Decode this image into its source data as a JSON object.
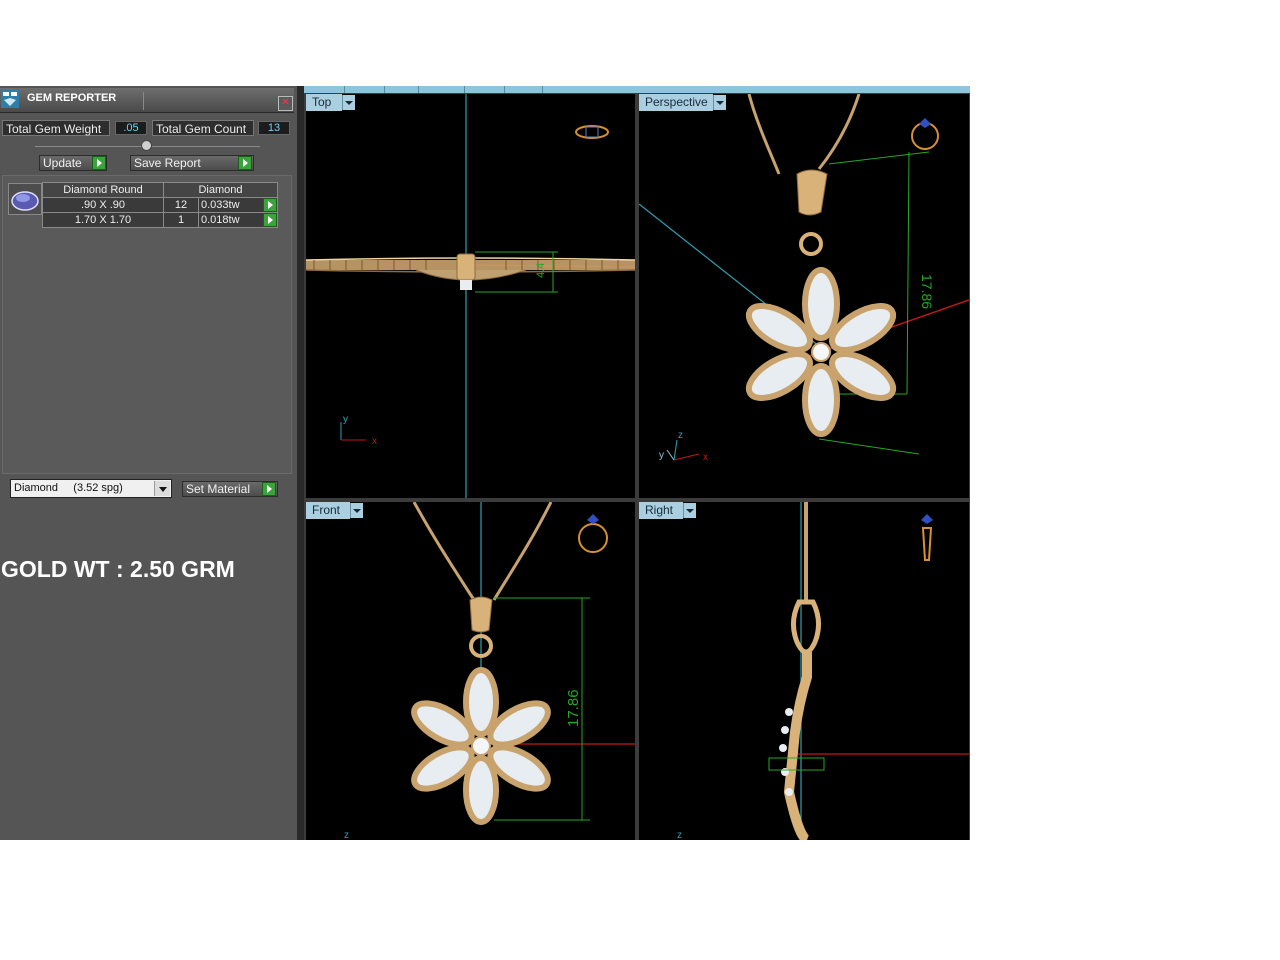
{
  "gem_reporter": {
    "title": "GEM REPORTER",
    "total_gem_weight_label": "Total Gem Weight",
    "total_gem_weight_value": ".05",
    "total_gem_count_label": "Total Gem Count",
    "total_gem_count_value": "13",
    "update_label": "Update",
    "save_report_label": "Save Report",
    "table": {
      "headers": [
        "Diamond Round",
        "Diamond"
      ],
      "rows": [
        {
          "size": ".90 X .90",
          "count": "12",
          "weight": "0.033tw"
        },
        {
          "size": "1.70 X 1.70",
          "count": "1",
          "weight": "0.018tw"
        }
      ]
    },
    "material_select": "Diamond     (3.52 spg)",
    "set_material_label": "Set Material"
  },
  "gold_weight_note": "GOLD WT : 2.50 GRM",
  "viewports": {
    "top": {
      "label": "Top",
      "dimension": "4.4",
      "axes": [
        "y",
        "x"
      ]
    },
    "perspective": {
      "label": "Perspective",
      "dimension": "17.86",
      "axes": [
        "z",
        "y",
        "x"
      ]
    },
    "front": {
      "label": "Front",
      "dimension": "17.86",
      "axes": [
        "z"
      ]
    },
    "right": {
      "label": "Right",
      "axes": [
        "z"
      ]
    }
  },
  "colors": {
    "gold": "#d9b27a",
    "diamond": "#e8edf2",
    "dimension_green": "#22aa22",
    "axis_cyan": "#2fa0b0",
    "axis_red": "#c01818",
    "label_bg": "#a9cfe0"
  }
}
